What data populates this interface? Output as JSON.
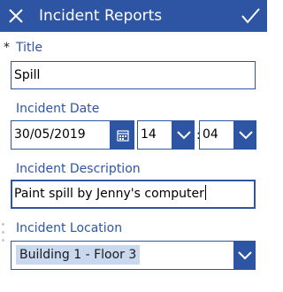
{
  "header": {
    "title": "Incident Reports",
    "bg_color": "#2e55a4"
  },
  "form": {
    "title": {
      "required_marker": "*",
      "label": "Title",
      "value": "Spill"
    },
    "incident_date": {
      "label": "Incident Date",
      "date_value": "30/05/2019",
      "hour_value": "14",
      "separator": ":",
      "minute_value": "04"
    },
    "incident_description": {
      "label": "Incident Description",
      "value": "Paint spill by Jenny's computer"
    },
    "incident_location": {
      "label": "Incident Location",
      "selected": "Building 1 - Floor 3"
    }
  },
  "icons": {
    "close": "close-icon",
    "submit": "checkmark-icon",
    "calendar": "calendar-icon",
    "dropdown": "chevron-down-icon"
  },
  "colors": {
    "accent": "#2e55a4",
    "selection_highlight": "#c9d8ef"
  }
}
